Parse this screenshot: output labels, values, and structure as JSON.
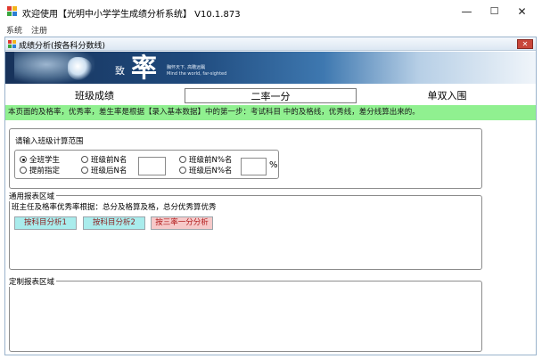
{
  "window": {
    "title": "欢迎使用【光明中小学学生成绩分析系统】 V10.1.873",
    "icon": "app-grid-icon",
    "controls": {
      "minimize": "—",
      "maximize": "☐",
      "close": "✕"
    }
  },
  "menu": {
    "items": [
      "系统",
      "注册"
    ]
  },
  "child_window": {
    "title": "成绩分析(按各科分数线)",
    "close": "✕"
  },
  "banner": {
    "small_char": "致",
    "big_char": "率",
    "slogan_cn": "胸怀天下, 高瞻远瞩",
    "slogan_en": "Mind the world, far-sighted"
  },
  "tabs": [
    {
      "label": "班级成绩",
      "active": false
    },
    {
      "label": "二率一分",
      "active": true
    },
    {
      "label": "单双入围",
      "active": false
    }
  ],
  "notice": "本页面的及格率，优秀率，差生率是根据【录入基本数据】中的第一步：考试科目 中的及格线，优秀线，差分线算出来的。",
  "range_group": {
    "title": "请输入班级计算范围",
    "radios": [
      {
        "label": "全班学生",
        "checked": true
      },
      {
        "label": "提前指定",
        "checked": false
      },
      {
        "label": "班级前N名",
        "checked": false
      },
      {
        "label": "班级后N名",
        "checked": false
      },
      {
        "label": "班级前N%名",
        "checked": false
      },
      {
        "label": "班级后N%名",
        "checked": false
      }
    ],
    "n_value": "",
    "percent_value": "",
    "percent_unit": "%"
  },
  "common_report": {
    "legend": "通用报表区域",
    "description": "班主任及格率优秀率根据：总分及格算及格，总分优秀算优秀",
    "buttons": [
      "按科目分析1",
      "按科目分析2",
      "按三率一分分析"
    ]
  },
  "custom_report": {
    "legend": "定制报表区域"
  },
  "colors": {
    "notice_bg": "#90f090",
    "button_cyan": "#a9ecec",
    "button_pink": "#f6c9c9",
    "button_cyan_text": "#8b1f1f",
    "button_pink_text": "#b01818"
  }
}
